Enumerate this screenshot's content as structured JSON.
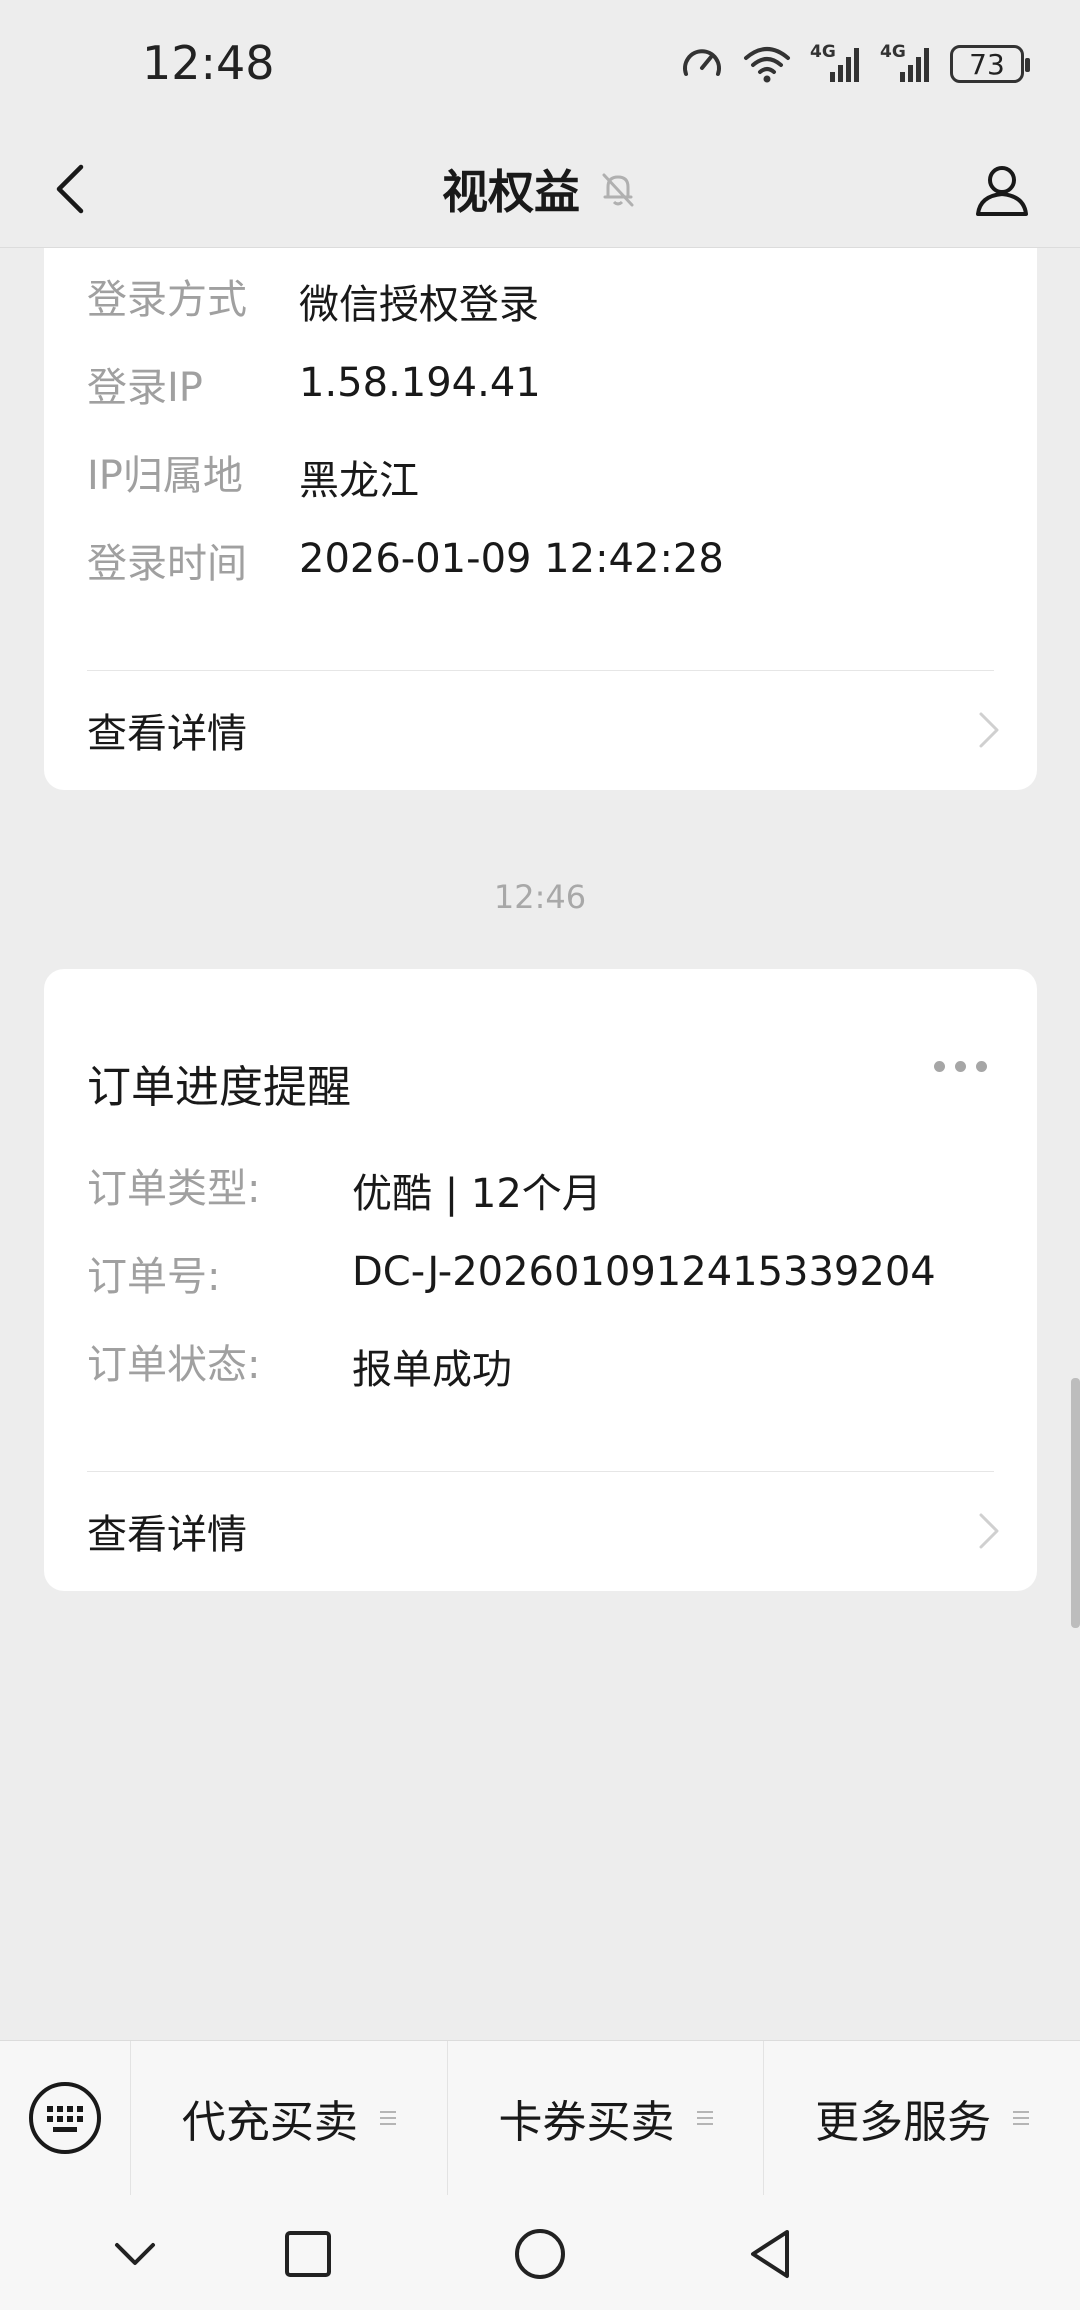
{
  "status": {
    "time": "12:48",
    "battery": "73",
    "network_1": "4G",
    "network_2": "4G"
  },
  "nav": {
    "title": "视权益"
  },
  "card1": {
    "rows": [
      {
        "key": "登录方式",
        "value": "微信授权登录"
      },
      {
        "key": "登录IP",
        "value": "1.58.194.41"
      },
      {
        "key": "IP归属地",
        "value": "黑龙江"
      },
      {
        "key": "登录时间",
        "value": "2026-01-09 12:42:28"
      }
    ],
    "detail_label": "查看详情"
  },
  "timestamp": "12:46",
  "card2": {
    "title": "订单进度提醒",
    "rows": [
      {
        "key": "订单类型:",
        "value": "优酷 | 12个月"
      },
      {
        "key": "订单号:",
        "value": "DC-J-20260109124153392​04"
      },
      {
        "key": "订单状态:",
        "value": "报单成功"
      }
    ],
    "detail_label": "查看详情"
  },
  "menu": {
    "items": [
      {
        "label": "代充买卖"
      },
      {
        "label": "卡券买卖"
      },
      {
        "label": "更多服务"
      }
    ]
  },
  "colors": {
    "background": "#ededed",
    "card": "#ffffff",
    "key_text": "#a0a0a0",
    "primary_text": "#191919"
  }
}
